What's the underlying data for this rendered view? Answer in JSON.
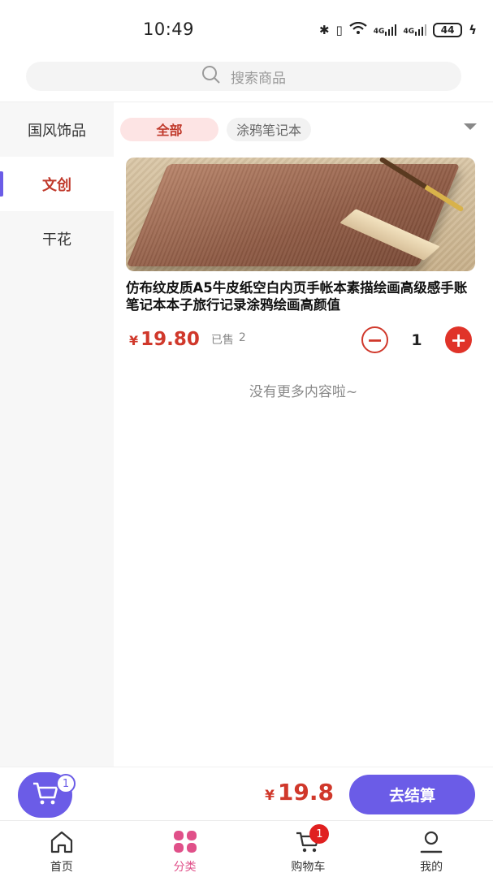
{
  "status_bar": {
    "time": "10:49",
    "network_label": "4G",
    "network_label_2": "4G",
    "battery": "44"
  },
  "search": {
    "placeholder": "搜索商品",
    "icon": "search-icon"
  },
  "sidebar": {
    "items": [
      {
        "label": "国风饰品",
        "active": false
      },
      {
        "label": "文创",
        "active": true
      },
      {
        "label": "干花",
        "active": false
      }
    ]
  },
  "chips": [
    {
      "label": "全部",
      "active": true
    },
    {
      "label": "涂鸦笔记本",
      "active": false
    }
  ],
  "product": {
    "title": "仿布纹皮质A5牛皮纸空白内页手帐本素描绘画高级感手账笔记本本子旅行记录涂鸦绘画高颜值",
    "currency": "¥",
    "price": "19.80",
    "sold_label": "已售",
    "sold_count": "2",
    "quantity": "1",
    "minus": "−",
    "plus": "+"
  },
  "list_end_text": "没有更多内容啦~",
  "checkout": {
    "cart_count": "1",
    "currency": "¥",
    "total": "19.8",
    "button_label": "去结算"
  },
  "tabbar": {
    "tabs": [
      {
        "label": "首页",
        "icon": "home-icon",
        "active": false
      },
      {
        "label": "分类",
        "icon": "category-icon",
        "active": true
      },
      {
        "label": "购物车",
        "icon": "cart-icon",
        "active": false,
        "badge": "1"
      },
      {
        "label": "我的",
        "icon": "profile-icon",
        "active": false
      }
    ]
  },
  "colors": {
    "accent": "#6b5ce7",
    "price": "#d0382b",
    "active_tab": "#e05089"
  }
}
